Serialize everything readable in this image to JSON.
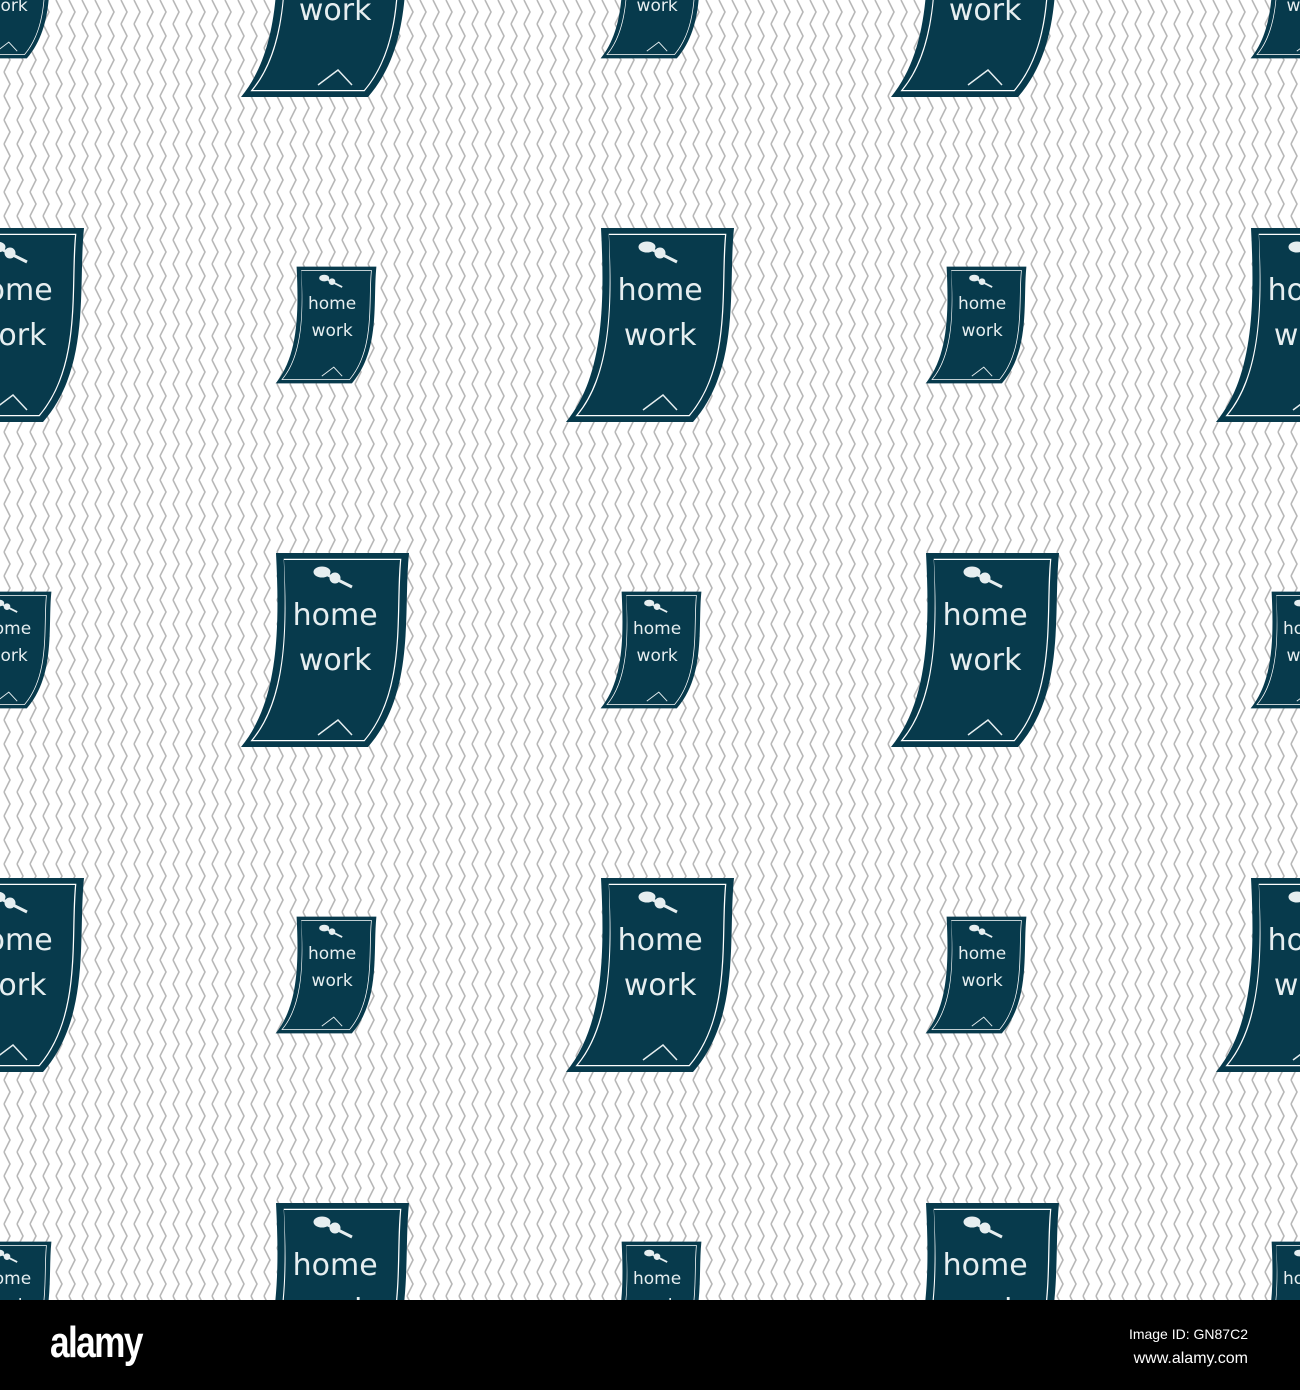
{
  "icon": {
    "line1": "home",
    "line2": "work",
    "fill": "#073a4c",
    "pattern_line": "#b8b8b8"
  },
  "footer": {
    "logo": "alamy",
    "image_id": "Image ID: GN87C2",
    "site": "www.alamy.com"
  }
}
